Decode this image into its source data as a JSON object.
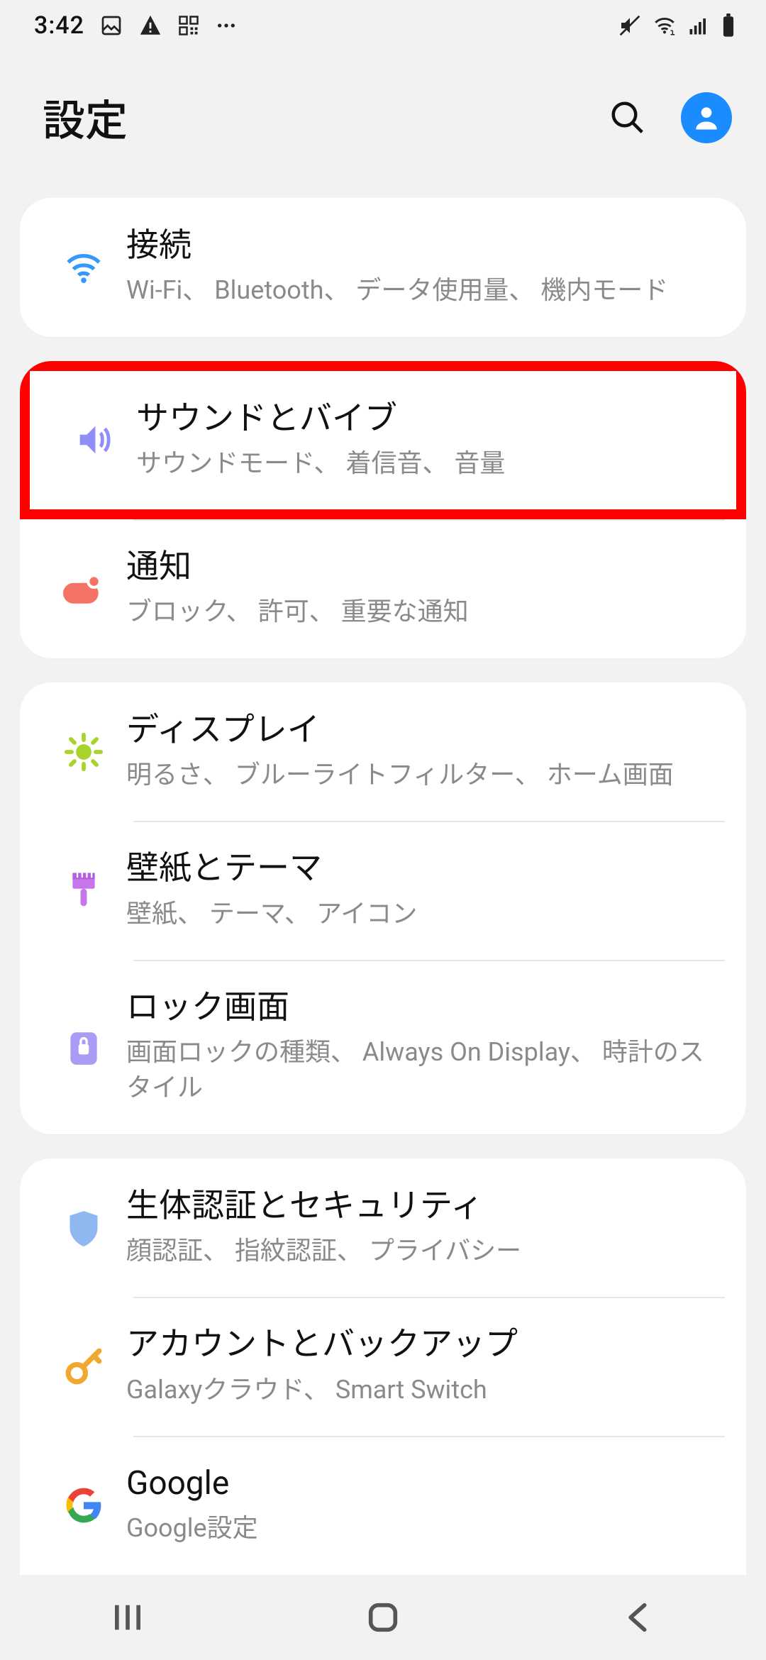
{
  "status": {
    "time": "3:42"
  },
  "header": {
    "title": "設定"
  },
  "groups": [
    {
      "items": [
        {
          "title": "接続",
          "sub": "Wi-Fi、 Bluetooth、 データ使用量、 機内モード"
        }
      ]
    },
    {
      "items": [
        {
          "title": "サウンドとバイブ",
          "sub": "サウンドモード、 着信音、 音量"
        },
        {
          "title": "通知",
          "sub": "ブロック、 許可、 重要な通知"
        }
      ]
    },
    {
      "items": [
        {
          "title": "ディスプレイ",
          "sub": "明るさ、 ブルーライトフィルター、 ホーム画面"
        },
        {
          "title": "壁紙とテーマ",
          "sub": "壁紙、 テーマ、 アイコン"
        },
        {
          "title": "ロック画面",
          "sub": "画面ロックの種類、 Always On Display、 時計のスタイル"
        }
      ]
    },
    {
      "items": [
        {
          "title": "生体認証とセキュリティ",
          "sub": "顔認証、 指紋認証、 プライバシー"
        },
        {
          "title": "アカウントとバックアップ",
          "sub": "Galaxyクラウド、 Smart Switch"
        },
        {
          "title": "Google",
          "sub": "Google設定"
        }
      ]
    }
  ]
}
